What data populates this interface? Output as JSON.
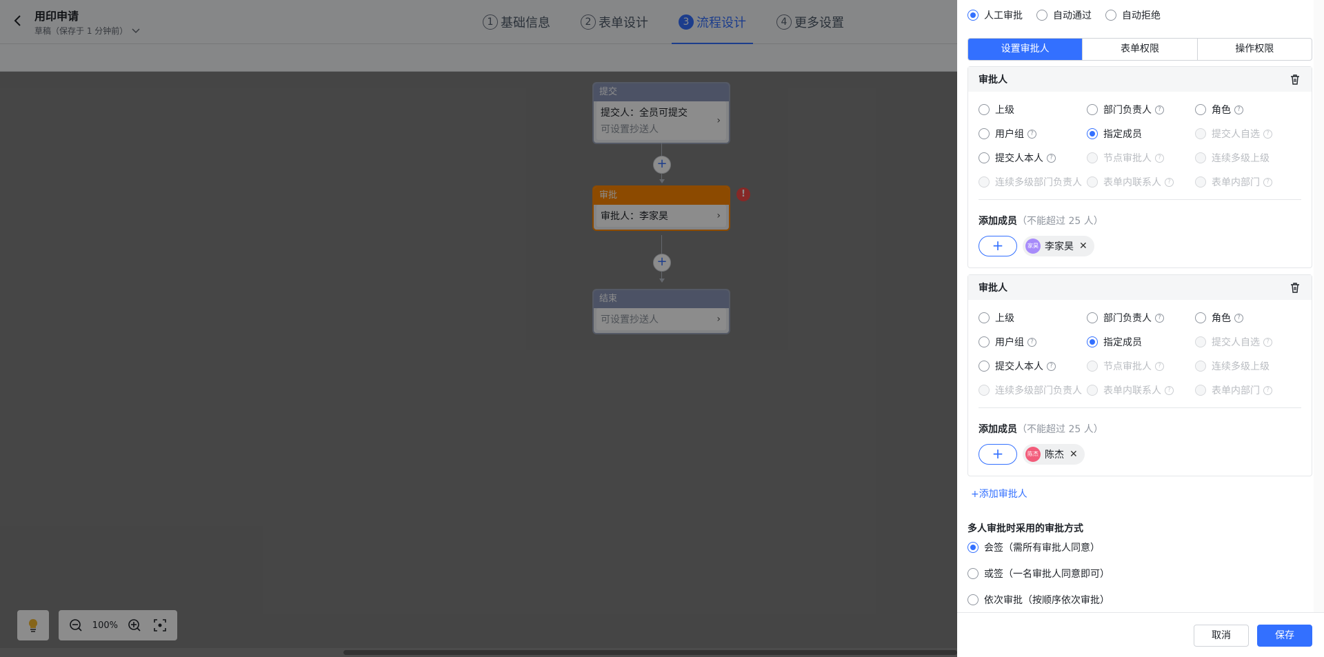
{
  "header": {
    "title": "用印申请",
    "draft_status": "草稿（保存于 1 分钟前）",
    "steps": [
      {
        "num": "1",
        "label": "基础信息"
      },
      {
        "num": "2",
        "label": "表单设计"
      },
      {
        "num": "3",
        "label": "流程设计"
      },
      {
        "num": "4",
        "label": "更多设置"
      }
    ]
  },
  "flow": {
    "submit": {
      "title": "提交",
      "line1": "提交人：全员可提交",
      "line2": "可设置抄送人"
    },
    "approve": {
      "title": "审批",
      "line1": "审批人：李家昊",
      "warning": "!"
    },
    "end": {
      "title": "结束",
      "line1": "可设置抄送人"
    },
    "zoom": "100%"
  },
  "panel": {
    "approve_modes": [
      "人工审批",
      "自动通过",
      "自动拒绝"
    ],
    "tabs": [
      "设置审批人",
      "表单权限",
      "操作权限"
    ],
    "card_title": "审批人",
    "options": [
      "上级",
      "部门负责人",
      "角色",
      "用户组",
      "指定成员",
      "提交人自选",
      "提交人本人",
      "节点审批人",
      "连续多级上级",
      "连续多级部门负责人",
      "表单内联系人",
      "表单内部门"
    ],
    "add_members_label": "添加成员",
    "add_members_hint": "（不能超过 25 人）",
    "add_member_plus": "+",
    "approvers": [
      {
        "name": "李家昊",
        "avatar": "家昊",
        "avatar_color": "#a78bfa"
      },
      {
        "name": "陈杰",
        "avatar": "陈杰",
        "avatar_color": "#f25c7a"
      }
    ],
    "add_approver": "+添加审批人",
    "multi_title": "多人审批时采用的审批方式",
    "multi_options": [
      "会签（需所有审批人同意）",
      "或签（一名审批人同意即可）",
      "依次审批（按顺序依次审批）"
    ],
    "cancel": "取消",
    "save": "保存"
  },
  "colors": {
    "accent": "#3370ff",
    "approve_node": "#ff8800",
    "warning": "#f54a45"
  }
}
